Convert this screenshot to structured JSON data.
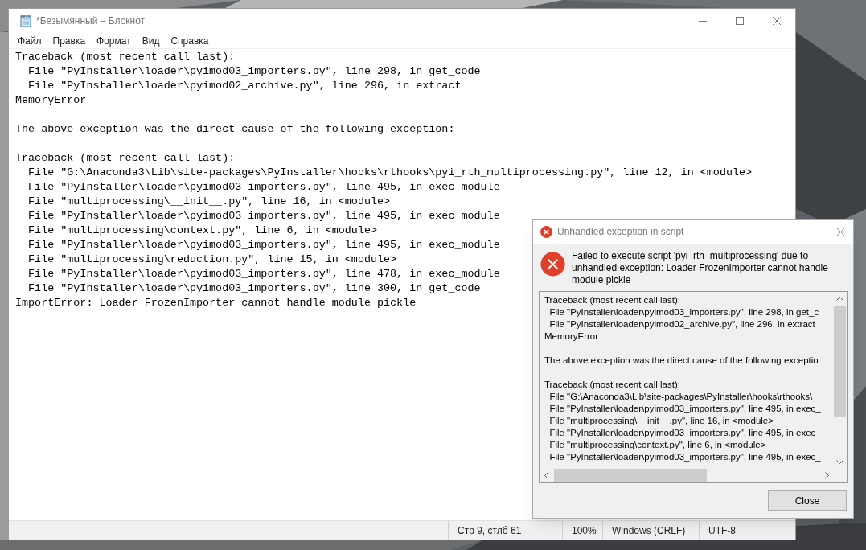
{
  "notepad": {
    "title": "*Безымянный – Блокнот",
    "menu": [
      "Файл",
      "Правка",
      "Формат",
      "Вид",
      "Справка"
    ],
    "text_blocks": [
      [
        "Traceback (most recent call last):",
        "  File \"PyInstaller\\loader\\pyimod03_importers.py\", line 298, in get_code",
        "  File \"PyInstaller\\loader\\pyimod02_archive.py\", line 296, in extract",
        "MemoryError"
      ],
      [
        "The above exception was the direct cause of the following exception:"
      ],
      [
        "Traceback (most recent call last):",
        "  File \"G:\\Anaconda3\\Lib\\site-packages\\PyInstaller\\hooks\\rthooks\\pyi_rth_multiprocessing.py\", line 12, in <module>",
        "  File \"PyInstaller\\loader\\pyimod03_importers.py\", line 495, in exec_module",
        "  File \"multiprocessing\\__init__.py\", line 16, in <module>",
        "  File \"PyInstaller\\loader\\pyimod03_importers.py\", line 495, in exec_module",
        "  File \"multiprocessing\\context.py\", line 6, in <module>",
        "  File \"PyInstaller\\loader\\pyimod03_importers.py\", line 495, in exec_module",
        "  File \"multiprocessing\\reduction.py\", line 15, in <module>",
        "  File \"PyInstaller\\loader\\pyimod03_importers.py\", line 478, in exec_module",
        "  File \"PyInstaller\\loader\\pyimod03_importers.py\", line 300, in get_code",
        "ImportError: Loader FrozenImporter cannot handle module pickle"
      ]
    ],
    "status_bar": [
      "Стр 9, стлб 61",
      "100%",
      "Windows (CRLF)",
      "UTF-8"
    ]
  },
  "dialog": {
    "title": "Unhandled exception in script",
    "message": "Failed to execute script 'pyi_rth_multiprocessing' due to unhandled exception: Loader FrozenImporter cannot handle module pickle",
    "detail_blocks": [
      [
        "Traceback (most recent call last):",
        "  File \"PyInstaller\\loader\\pyimod03_importers.py\", line 298, in get_c",
        "  File \"PyInstaller\\loader\\pyimod02_archive.py\", line 296, in extract",
        "MemoryError"
      ],
      [
        "The above exception was the direct cause of the following exceptio"
      ],
      [
        "Traceback (most recent call last):",
        "  File \"G:\\Anaconda3\\Lib\\site-packages\\PyInstaller\\hooks\\rthooks\\",
        "  File \"PyInstaller\\loader\\pyimod03_importers.py\", line 495, in exec_",
        "  File \"multiprocessing\\__init__.py\", line 16, in <module>",
        "  File \"PyInstaller\\loader\\pyimod03_importers.py\", line 495, in exec_",
        "  File \"multiprocessing\\context.py\", line 6, in <module>",
        "  File \"PyInstaller\\loader\\pyimod03_importers.py\", line 495, in exec_"
      ]
    ],
    "button": "Close"
  }
}
